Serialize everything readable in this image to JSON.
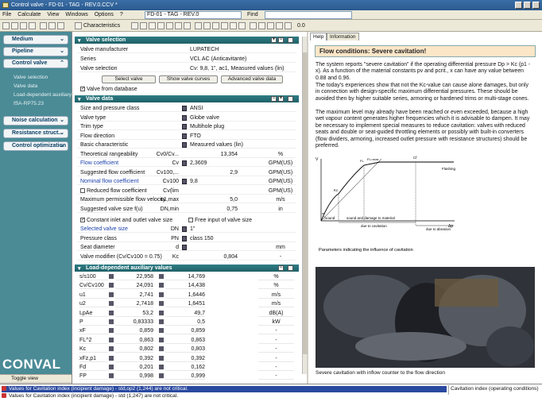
{
  "window": {
    "title": "Control valve - FD-01 - TAG - REV.0.CCV *"
  },
  "menu": {
    "items": [
      "File",
      "Calculate",
      "View",
      "Windows",
      "Options",
      "?"
    ],
    "doc": "FD-01 - TAG - REV.0",
    "find": "Find"
  },
  "toolbar": {
    "characteristics": "Characteristics",
    "zoom": "0.0"
  },
  "sidebar": {
    "medium": "Medium",
    "pipeline": "Pipeline",
    "control_valve": "Control valve",
    "subs": [
      "Valve selection",
      "Valve data",
      "Load-dependent auxiliary ...",
      "ISA-RP75.23"
    ],
    "noise": "Noise calculation",
    "resistance": "Resistance struct...",
    "optimization": "Control optimization",
    "logo": "CONVAL",
    "toggle": "Toggle view"
  },
  "valve_selection": {
    "header": "Valve selection",
    "manufacturer_label": "Valve manufacturer",
    "manufacturer": "LUPATECH",
    "series_label": "Series",
    "series": "VCL AC (Anticavitante)",
    "selection_label": "Valve selection",
    "selection": "Cv: 9,8, 1\", ac1, Measured values (lin)",
    "btn_select": "Select valve",
    "btn_curves": "Show valve curves",
    "btn_advanced": "Advanced valve data",
    "from_db": "Valve from database"
  },
  "valve_data": {
    "header": "Valve data",
    "rows": [
      {
        "label": "Size and pressure class",
        "sym": "",
        "val": "ANSI",
        "unit": "",
        "icon": true
      },
      {
        "label": "Valve type",
        "sym": "",
        "val": "Globe valve",
        "unit": "",
        "icon": true
      },
      {
        "label": "Trim type",
        "sym": "",
        "val": "Multihole plug",
        "unit": "",
        "icon": true
      },
      {
        "label": "Flow direction",
        "sym": "",
        "val": "FTO",
        "unit": "",
        "icon": true
      },
      {
        "label": "Basic characteristic",
        "sym": "",
        "val": "Measured values (lin)",
        "unit": "",
        "icon": true
      },
      {
        "label": "Theoretical rangeability",
        "sym": "Cv0/Cv...",
        "val": "13,354",
        "unit": "%",
        "icon": false
      },
      {
        "label": "Flow coefficient",
        "sym": "Cv",
        "val": "2,3609",
        "unit": "GPM(US)",
        "icon": true,
        "blue": true
      },
      {
        "label": "Suggested flow coefficient",
        "sym": "Cv100,...",
        "val": "2,9",
        "unit": "GPM(US)",
        "icon": false
      },
      {
        "label": "Nominal flow coefficient",
        "sym": "Cv100",
        "val": "9,8",
        "unit": "GPM(US)",
        "icon": true,
        "blue": true
      },
      {
        "label": "Reduced flow coefficient",
        "sym": "Cv(lim",
        "val": "",
        "unit": "GPM(US)",
        "icon": false,
        "cb": true
      },
      {
        "label": "Maximum permissible flow velocity",
        "sym": "u1,max",
        "val": "5,0",
        "unit": "m/s",
        "icon": false
      },
      {
        "label": "Suggested valve size f(u)",
        "sym": "DN,min",
        "val": "0,75",
        "unit": "in",
        "icon": false
      }
    ],
    "constant_io": "Constant inlet and outlet valve size",
    "free_input": "Free input of valve size",
    "rows2": [
      {
        "label": "Selected valve size",
        "sym": "DN",
        "val": "1\"",
        "unit": "",
        "icon": true,
        "blue": true
      },
      {
        "label": "Pressure class",
        "sym": "PN",
        "val": "class 150",
        "unit": "",
        "icon": true
      },
      {
        "label": "Seat diameter",
        "sym": "d",
        "val": "",
        "unit": "mm",
        "icon": true
      },
      {
        "label": "Valve modifier (Cv/Cv100 = 0.75)",
        "sym": "Kc",
        "val": "0,804",
        "unit": "-",
        "icon": false
      }
    ]
  },
  "aux": {
    "header": "Load-dependent auxiliary values",
    "rows": [
      {
        "k": "s/s100",
        "a": "22,958",
        "b": "14,769",
        "u": "%"
      },
      {
        "k": "Cv/Cv100",
        "a": "24,091",
        "b": "14,438",
        "u": "%"
      },
      {
        "k": "u1",
        "a": "2,741",
        "b": "1,6446",
        "u": "m/s"
      },
      {
        "k": "u2",
        "a": "2,7418",
        "b": "1,6451",
        "u": "m/s"
      },
      {
        "k": "LpAe",
        "a": "53,2",
        "b": "49,7",
        "u": "dB(A)"
      },
      {
        "k": "P",
        "a": "0,83333",
        "b": "0,5",
        "u": "kW"
      },
      {
        "k": "xF",
        "a": "0,859",
        "b": "0,859",
        "u": "-"
      },
      {
        "k": "FL^2",
        "a": "0,863",
        "b": "0,863",
        "u": "-"
      },
      {
        "k": "Kc",
        "a": "0,802",
        "b": "0,803",
        "u": "-"
      },
      {
        "k": "xFz,p1",
        "a": "0,392",
        "b": "0,392",
        "u": "-"
      },
      {
        "k": "Fd",
        "a": "0,201",
        "b": "0,162",
        "u": "-"
      },
      {
        "k": "FP",
        "a": "0,998",
        "b": "0,999",
        "u": "-"
      }
    ]
  },
  "help": {
    "tabs": [
      "Help",
      "Information"
    ],
    "title": "Flow conditions: Severe cavitation!",
    "p1": "The system reports \"severe cavitation\" if the operating differential pressure Dp > Kc (p1 - x). As a function of the material constants pv and pcrit., x can have any value between 0.88 and 0.96.",
    "p2": "The today's experiences show that not the Kc-value can cause alone damages, but only in connection with design-specific maximum differential pressures. These should be avoided then by higher suitable series, armoring or hardened trims or multi-stage cones.",
    "p3": "The maximum level may already have been reached or even exceeded, because a high wet vapour content generates higher frequencies which it is advisable to dampen. It may be necessary to implement special measures to reduce cavitation: valves with reduced seats and double or seat-guided throttling elements or possibly with built-in converters (flow dividers, armoring, increased outlet pressure with resistance structures) should be preferred.",
    "graph": {
      "labels": {
        "v": "V",
        "fl": "FL",
        "fl2": "FL=max",
        "cf": "Cf",
        "kc": "Kc",
        "sound": "sound",
        "zi": "zi",
        "flashing": "Flashing",
        "dp": "Δp",
        "sdm": "sound and damage to material",
        "dtc": "due to cavitation",
        "dta": "due to abrasion"
      },
      "caption": "Parameters indicating the influence of cavitation"
    },
    "photo_caption": "Severe cavitation with inflow counter to the flow direction"
  },
  "status": {
    "rows": [
      "Values for Cavitation index (incipient damage) - std,op2 (1,244) are not critical.",
      "Values for Cavitation index (incipient damage) - std (1,247) are not critical."
    ],
    "right": "Cavitation index (operating conditions)"
  }
}
